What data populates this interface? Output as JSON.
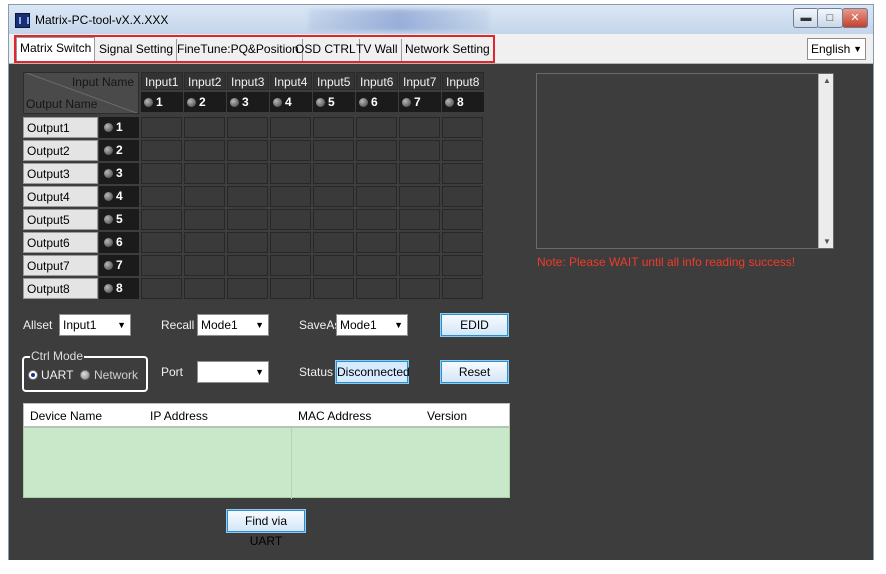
{
  "window": {
    "title": "Matrix-PC-tool-vX.X.XXX",
    "buttons": {
      "minimize": "▬",
      "maximize": "□",
      "close": "✕"
    }
  },
  "tabs": [
    {
      "label": "Matrix Switch"
    },
    {
      "label": "Signal Setting"
    },
    {
      "label": "FineTune:PQ&Position"
    },
    {
      "label": "OSD CTRL"
    },
    {
      "label": "TV Wall"
    },
    {
      "label": "Network Setting"
    }
  ],
  "language": {
    "value": "English",
    "arrow": "▼"
  },
  "matrix": {
    "corner_input": "Input Name",
    "corner_output": "Output Name",
    "inputs": [
      {
        "name": "Input1",
        "index": "1"
      },
      {
        "name": "Input2",
        "index": "2"
      },
      {
        "name": "Input3",
        "index": "3"
      },
      {
        "name": "Input4",
        "index": "4"
      },
      {
        "name": "Input5",
        "index": "5"
      },
      {
        "name": "Input6",
        "index": "6"
      },
      {
        "name": "Input7",
        "index": "7"
      },
      {
        "name": "Input8",
        "index": "8"
      }
    ],
    "outputs": [
      {
        "name": "Output1",
        "index": "1"
      },
      {
        "name": "Output2",
        "index": "2"
      },
      {
        "name": "Output3",
        "index": "3"
      },
      {
        "name": "Output4",
        "index": "4"
      },
      {
        "name": "Output5",
        "index": "5"
      },
      {
        "name": "Output6",
        "index": "6"
      },
      {
        "name": "Output7",
        "index": "7"
      },
      {
        "name": "Output8",
        "index": "8"
      }
    ]
  },
  "controls": {
    "allset_label": "Allset",
    "allset_value": "Input1",
    "recall_label": "Recall",
    "recall_value": "Mode1",
    "saveas_label": "SaveAs",
    "saveas_value": "Mode1",
    "edid_button": "EDID",
    "ctrl_mode_label": "Ctrl Mode",
    "uart_label": "UART",
    "network_label": "Network",
    "port_label": "Port",
    "port_value": "",
    "status_label": "Status",
    "status_value": "Disconnected",
    "reset_button": "Reset",
    "arrow": "▼"
  },
  "device_table": {
    "columns": [
      "Device Name",
      "IP Address",
      "MAC Address",
      "Version"
    ],
    "rows": []
  },
  "find_button": "Find via UART",
  "note": "Note: Please WAIT until all info reading success!",
  "scroll_up": "▲",
  "scroll_down": "▼"
}
